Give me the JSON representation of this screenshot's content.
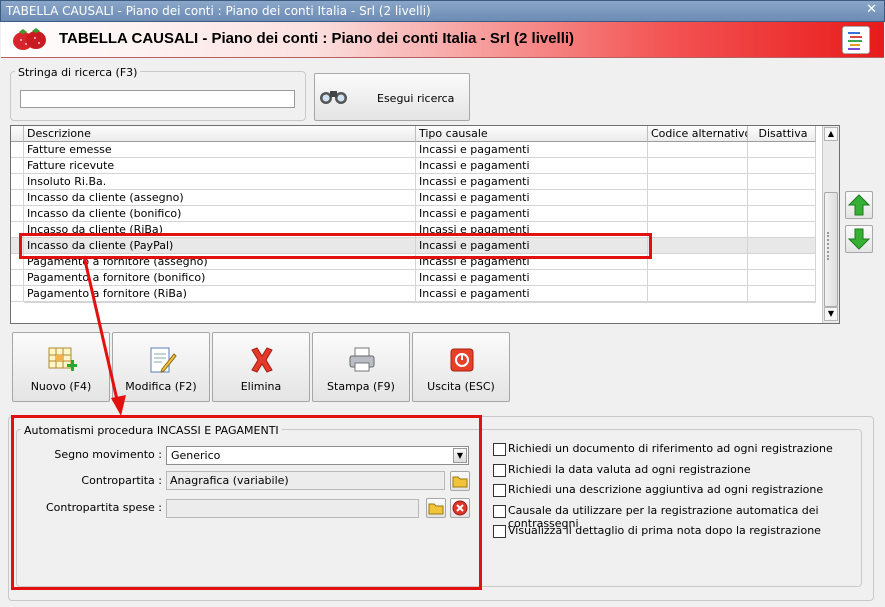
{
  "window": {
    "title": "TABELLA CAUSALI - Piano dei conti : Piano dei conti Italia - Srl (2 livelli)"
  },
  "header": {
    "title": "TABELLA CAUSALI - Piano dei conti : Piano dei conti Italia - Srl (2 livelli)"
  },
  "search": {
    "group_label": "Stringa di ricerca (F3)",
    "value": "",
    "button_label": "Esegui ricerca"
  },
  "table": {
    "columns": [
      "Descrizione",
      "Tipo causale",
      "Codice alternativo",
      "Disattiva"
    ],
    "rows": [
      [
        "Fatture emesse",
        "Incassi e pagamenti",
        "",
        ""
      ],
      [
        "Fatture ricevute",
        "Incassi e pagamenti",
        "",
        ""
      ],
      [
        "Insoluto Ri.Ba.",
        "Incassi e pagamenti",
        "",
        ""
      ],
      [
        "Incasso da cliente (assegno)",
        "Incassi e pagamenti",
        "",
        ""
      ],
      [
        "Incasso da cliente (bonifico)",
        "Incassi e pagamenti",
        "",
        ""
      ],
      [
        "Incasso da cliente (RiBa)",
        "Incassi e pagamenti",
        "",
        ""
      ],
      [
        "Incasso da cliente (PayPal)",
        "Incassi e pagamenti",
        "",
        ""
      ],
      [
        "Pagamento a fornitore (assegno)",
        "Incassi e pagamenti",
        "",
        ""
      ],
      [
        "Pagamento a fornitore (bonifico)",
        "Incassi e pagamenti",
        "",
        ""
      ],
      [
        "Pagamento a fornitore (RiBa)",
        "Incassi e pagamenti",
        "",
        ""
      ]
    ],
    "selected_index": 6
  },
  "toolbar": {
    "new": "Nuovo (F4)",
    "edit": "Modifica (F2)",
    "delete": "Elimina",
    "print": "Stampa (F9)",
    "exit": "Uscita (ESC)"
  },
  "automation": {
    "group_label": "Automatismi procedura INCASSI E PAGAMENTI",
    "segno_label": "Segno movimento :",
    "segno_value": "Generico",
    "contropartita_label": "Contropartita :",
    "contropartita_value": "Anagrafica (variabile)",
    "contropartita_spese_label": "Contropartita spese :",
    "contropartita_spese_value": ""
  },
  "options": [
    {
      "label": "Richiedi un documento di riferimento ad ogni registrazione",
      "checked": false
    },
    {
      "label": "Richiedi la data valuta ad ogni registrazione",
      "checked": false
    },
    {
      "label": "Richiedi una descrizione aggiuntiva ad ogni registrazione",
      "checked": false
    },
    {
      "label": "Causale da utilizzare per la registrazione automatica dei contrassegni",
      "checked": false
    },
    {
      "label": "Visualizza il dettaglio di prima nota dopo la registrazione",
      "checked": false
    }
  ],
  "colors": {
    "highlight": "#e31010",
    "arrow_up": "#2fa82f",
    "arrow_down": "#2fa82f"
  }
}
